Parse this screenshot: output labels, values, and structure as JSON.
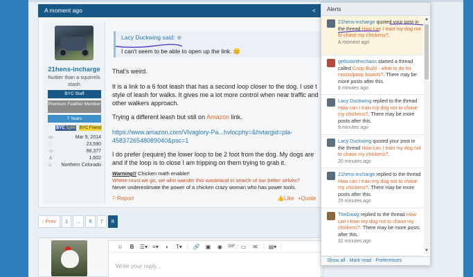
{
  "post": {
    "time": "A moment ago",
    "share_icon": "share-icon",
    "user": {
      "name": "21hens-incharge",
      "title": "Nuttier than a squirrels stash",
      "badges": [
        "BYC Staff",
        "Premium Feather Member",
        "7 Years"
      ],
      "tag_spirit_a": "BYC ",
      "tag_spirit_b": "Spirit",
      "tag_friend": "BYC Friend",
      "stats": [
        {
          "icon": "calendar-icon",
          "value": "Mar 9, 2014"
        },
        {
          "icon": "messages-icon",
          "value": "23,590"
        },
        {
          "icon": "reactions-icon",
          "value": "98,377"
        },
        {
          "icon": "trophy-icon",
          "value": "1,602"
        },
        {
          "icon": "location-icon",
          "value": "Northern Colorado"
        }
      ]
    },
    "quote": {
      "author": "Lacy Duckwing said:",
      "text": "I can't seem to be able to open up the link. 😊"
    },
    "paragraphs": {
      "p1": "That's weird.",
      "p2": "It is a link to a 6 foot leash that has a second loop closer to the dog. I use t style of leash for walks. It gives me a lot more control when near traffic and other walkers approach.",
      "p3_pre": "Trying a different leash but still on ",
      "p3_link": "Amazon",
      "p3_post": " link.",
      "url": "https://www.amazon.com/Vlvaglory-Pa...hvlocphy=&hvtargid=pla-4583726548089040&psc=1",
      "p4": "I do prefer (require) the lower loop to be 2 foot from the dog. My dogs are and if the loop is to close I am tripping on them trying to grab it."
    },
    "signature": {
      "warning": "Warning!!",
      "warning_rest": " Chicken math enabler!",
      "line2": "Where must we go, we who wander this wasteland in search of our better selves?",
      "line3": "Never underestimate the power of a chicken crazy woman who has power tools."
    },
    "actions": {
      "report": "Report",
      "like": "Like",
      "quote": "Quote"
    }
  },
  "pager": {
    "prev": "‹ Prev",
    "pages": [
      "1",
      "...",
      "6",
      "7",
      "8"
    ],
    "current": "8"
  },
  "editor": {
    "placeholder": "Write your reply...",
    "tools": [
      "☺",
      "B",
      "☰▾",
      "≡▾",
      "◐",
      "T▾",
      "⋮",
      "🔗",
      "▣",
      "◉",
      "GIF",
      "▭",
      "✉",
      "⋮",
      "▤▾",
      "⋮"
    ]
  },
  "alerts": {
    "title": "Alerts",
    "footer": "Show all · Mark read · Preferences",
    "items": [
      {
        "who": "21hens-incharge",
        "pre": " quoted your post in the thread ",
        "thread": "How can I train my dog not to chase my chickens?",
        "post": ".",
        "time": "A moment ago",
        "unread": true,
        "color": "#5a6b7d"
      },
      {
        "who": "getlostinthechaos",
        "pre": " started a thread called ",
        "thread": "Coop Build - what to do for roosts/poop boards?",
        "post": ". There may be more posts after this.",
        "time": "8 minutes ago",
        "unread": false,
        "color": "#b04a3a"
      },
      {
        "who": "Lacy Duckwing",
        "pre": " replied to the thread ",
        "thread": "How can I train my dog not to chase my chickens?",
        "post": ". There may be more posts after this.",
        "time": "9 minutes ago",
        "unread": false,
        "color": "#5e6f7c"
      },
      {
        "who": "Lacy Duckwing",
        "pre": " quoted your post in the thread ",
        "thread": "How can I train my dog not to chase my chickens?",
        "post": ".",
        "time": "20 minutes ago",
        "unread": false,
        "color": "#5e6f7c"
      },
      {
        "who": "21hens-incharge",
        "pre": " replied to the thread ",
        "thread": "How can I train my dog not to chase my chickens?",
        "post": ". There may be more posts after this.",
        "time": "29 minutes ago",
        "unread": false,
        "color": "#5a6b7d"
      },
      {
        "who": "TheDawg",
        "pre": " replied to the thread ",
        "thread": "How can I train my dog not to chase my chickens?",
        "post": ". There may be more posts after this.",
        "time": "32 minutes ago",
        "unread": false,
        "color": "#8a6a3a"
      }
    ]
  }
}
